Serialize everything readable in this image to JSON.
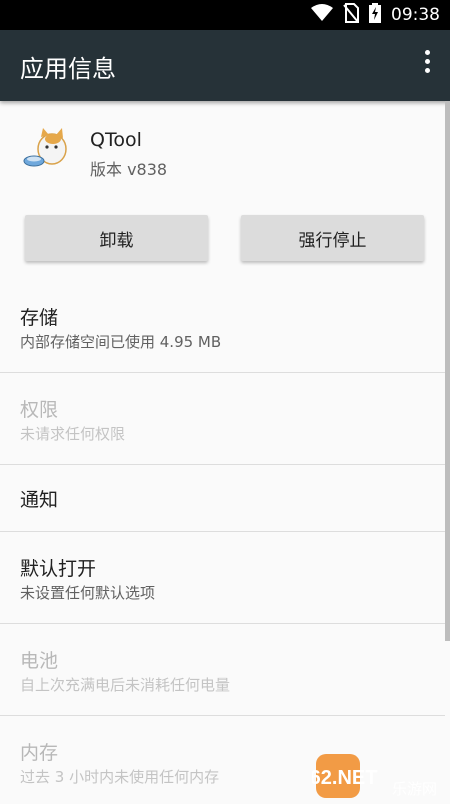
{
  "status_bar": {
    "time": "09:38"
  },
  "app_bar": {
    "title": "应用信息"
  },
  "app": {
    "name": "QTool",
    "version": "版本 v838"
  },
  "buttons": {
    "uninstall": "卸载",
    "force_stop": "强行停止"
  },
  "rows": [
    {
      "title": "存储",
      "subtitle": "内部存储空间已使用 4.95 MB",
      "enabled": true
    },
    {
      "title": "权限",
      "subtitle": "未请求任何权限",
      "enabled": false
    },
    {
      "title": "通知",
      "subtitle": "",
      "enabled": true
    },
    {
      "title": "默认打开",
      "subtitle": "未设置任何默认选项",
      "enabled": true
    },
    {
      "title": "电池",
      "subtitle": "自上次充满电后未消耗任何电量",
      "enabled": false
    },
    {
      "title": "内存",
      "subtitle": "过去 3 小时内未使用任何内存",
      "enabled": false
    }
  ],
  "watermark": {
    "brand": "962.NET",
    "site": "乐游网"
  },
  "colors": {
    "app_bar": "#263238",
    "status_bar": "#000000",
    "button": "#dcdcdc",
    "background": "#fafafa"
  },
  "icons": [
    "wifi-icon",
    "no-sim-icon",
    "battery-charging-icon",
    "more-vert-icon",
    "app-cat-icon"
  ]
}
